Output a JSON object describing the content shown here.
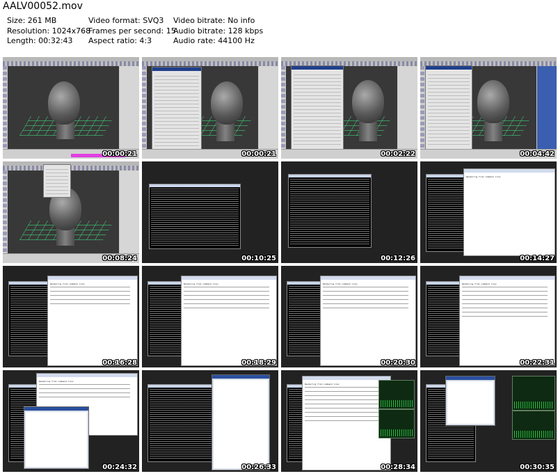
{
  "file_title": "AALV00052.mov",
  "info": {
    "col1": [
      "Size: 261 MB",
      "Resolution: 1024x768",
      "Length: 00:32:43"
    ],
    "col2": [
      "Video format: SVQ3",
      "Frames per second: 15",
      "Aspect ratio: 4:3"
    ],
    "col3": [
      "Video bitrate: No info",
      "Audio bitrate: 128 kbps",
      "Audio rate: 44100 Hz"
    ]
  },
  "thumbnails": [
    {
      "timestamp": "00:00:21",
      "type": "maya"
    },
    {
      "timestamp": "00:00:21",
      "type": "maya-dialog"
    },
    {
      "timestamp": "00:02:22",
      "type": "maya-dialog"
    },
    {
      "timestamp": "00:04:42",
      "type": "maya-dialog"
    },
    {
      "timestamp": "00:08:24",
      "type": "maya-menu"
    },
    {
      "timestamp": "00:10:25",
      "type": "console"
    },
    {
      "timestamp": "00:12:26",
      "type": "console"
    },
    {
      "timestamp": "00:14:27",
      "type": "console-notepad"
    },
    {
      "timestamp": "00:16:28",
      "type": "console-notepad"
    },
    {
      "timestamp": "00:18:29",
      "type": "console-notepad"
    },
    {
      "timestamp": "00:20:30",
      "type": "console-notepad"
    },
    {
      "timestamp": "00:22:31",
      "type": "console-notepad"
    },
    {
      "timestamp": "00:24:32",
      "type": "notepad-explorer"
    },
    {
      "timestamp": "00:26:33",
      "type": "console-explorer"
    },
    {
      "timestamp": "00:28:34",
      "type": "console-monitor"
    },
    {
      "timestamp": "00:30:35",
      "type": "console-monitor"
    }
  ],
  "notepad_text": {
    "heading": "Rendering from command line:",
    "lines": [
      "Render -r mr file.mb    ...launch maya renderer",
      "Render -r mr -v 5 file.mb   ...render using mental ray",
      "Render -r sw -s 1 -e 100 file.mb   ...render w/ pixels",
      "Render -r mr -x 2 file.mb   ...render w/ pixels w/ mental ray"
    ]
  },
  "colors": {
    "background": "#ffffff",
    "maya_ui": "#c9c9c9",
    "viewport": "#383838",
    "console": "#000000",
    "dark_frame": "#222222",
    "grid": "#3cbe6e",
    "timeline_highlight": "#e040e0"
  }
}
